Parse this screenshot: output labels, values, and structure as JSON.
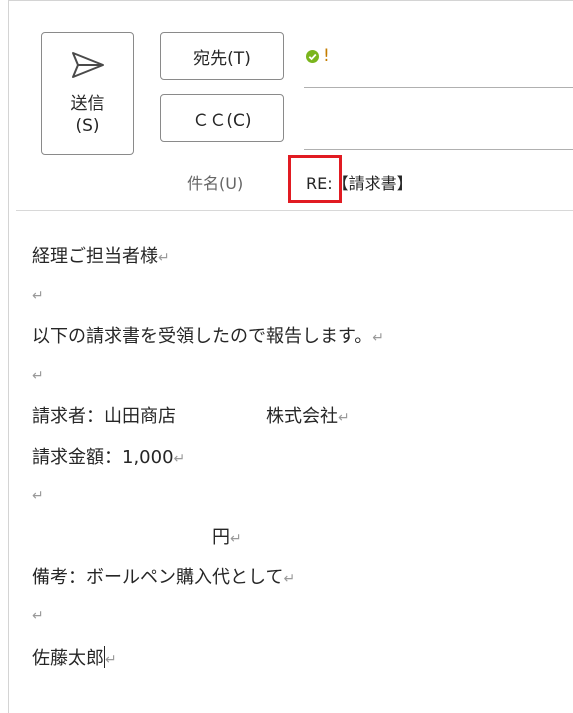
{
  "header": {
    "send_label": "送信\n(S)",
    "to_label": "宛先(T)",
    "cc_label": "ＣＣ(C)",
    "to_value": "!",
    "cc_value": "",
    "subject_label": "件名(U)",
    "subject_value": "RE:【請求書】",
    "icons": {
      "send": "send-paper-plane-icon",
      "recipient_status": "green-check-icon"
    },
    "colors": {
      "highlight": "#e11b22",
      "check": "#7ab51d"
    }
  },
  "body": {
    "paragraph_mark": "↵",
    "lines": [
      "経理ご担当者様",
      "",
      "以下の請求書を受領したので報告します。",
      "",
      "請求者：山田商店　　　　　株式会社",
      "請求金額：1,000",
      "",
      "　　　　　　　　　　円",
      "備考：ボールペン購入代として",
      "",
      "佐藤太郎"
    ]
  }
}
